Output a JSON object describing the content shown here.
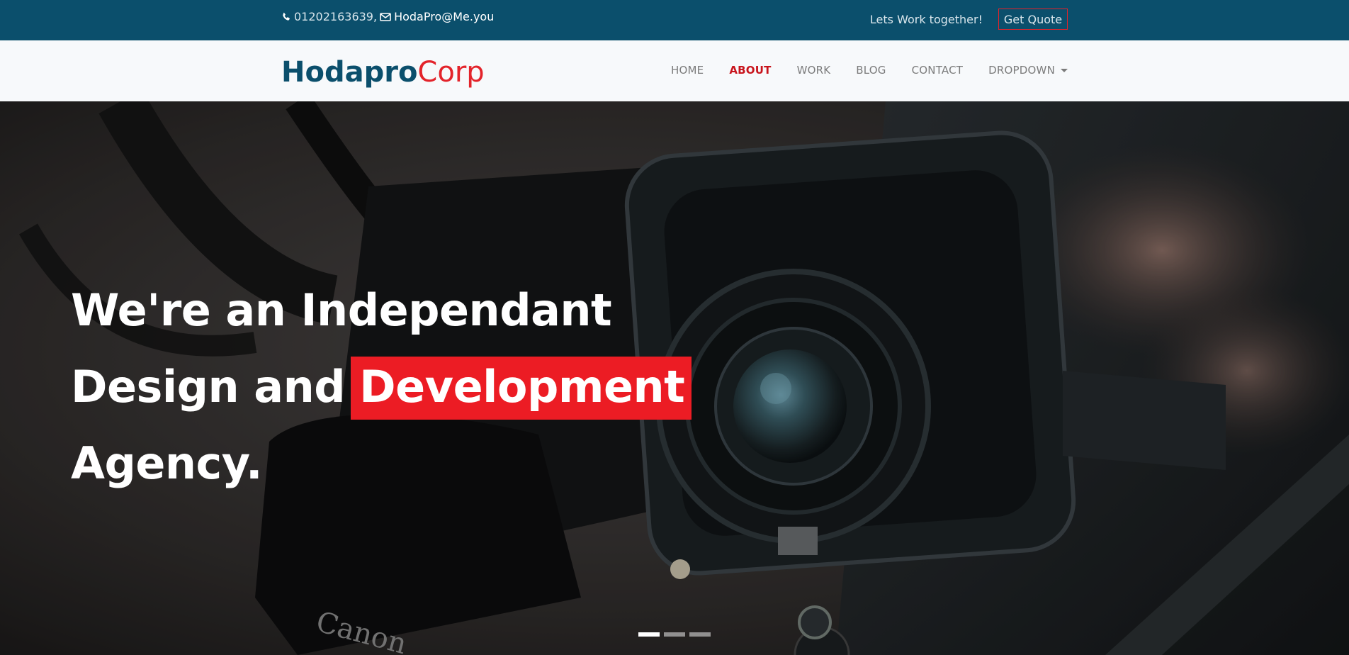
{
  "topbar": {
    "phone": "01202163639,",
    "email": "HodaPro@Me.you",
    "cta_text": "Lets Work together!",
    "quote_button": "Get Quote"
  },
  "brand": {
    "part1": "Hodapro",
    "part2": "Corp"
  },
  "nav": {
    "items": [
      {
        "label": "HOME",
        "active": false
      },
      {
        "label": "ABOUT",
        "active": true
      },
      {
        "label": "WORK",
        "active": false
      },
      {
        "label": "BLOG",
        "active": false
      },
      {
        "label": "CONTACT",
        "active": false
      },
      {
        "label": "DROPDOWN",
        "active": false
      }
    ]
  },
  "hero": {
    "line1": "We're an Independant",
    "line2_prefix": "Design and",
    "line2_highlight": "Development",
    "line3": "Agency.",
    "slides": [
      {
        "active": true
      },
      {
        "active": false
      },
      {
        "active": false
      }
    ]
  },
  "colors": {
    "topbar": "#0b4f6c",
    "brand_primary": "#0b4f6c",
    "accent": "#e3232a",
    "highlight": "#ec1c24",
    "nav_text": "#7b7b7b",
    "nav_active": "#c8141c"
  },
  "icons": {
    "phone": "phone-icon",
    "email": "envelope-icon",
    "dropdown": "caret-down-icon"
  }
}
